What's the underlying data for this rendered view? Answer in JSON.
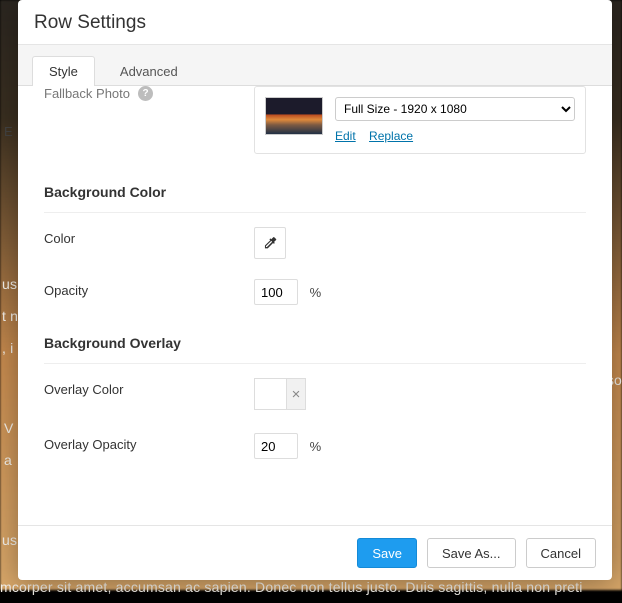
{
  "panel": {
    "title": "Row Settings"
  },
  "tabs": {
    "style": "Style",
    "advanced": "Advanced"
  },
  "fallback": {
    "label": "Fallback Photo",
    "size_selected": "Full Size - 1920 x 1080",
    "edit": "Edit",
    "replace": "Replace"
  },
  "bg_color": {
    "heading": "Background Color",
    "color_label": "Color",
    "opacity_label": "Opacity",
    "opacity_value": "100",
    "opacity_unit": "%"
  },
  "bg_overlay": {
    "heading": "Background Overlay",
    "color_label": "Overlay Color",
    "clear_symbol": "×",
    "opacity_label": "Overlay Opacity",
    "opacity_value": "20",
    "opacity_unit": "%"
  },
  "footer": {
    "save": "Save",
    "save_as": "Save As...",
    "cancel": "Cancel"
  },
  "partial_letter": "E",
  "bg_lines": {
    "l1": "us",
    "l2": "t n",
    "l3": ", i",
    "l4": "so",
    "l5": "V",
    "l6": "a",
    "l7": "us",
    "l8": "mcorper sit amet, accumsan ac sapien. Donec non tellus justo. Duis sagittis, nulla non preti"
  }
}
